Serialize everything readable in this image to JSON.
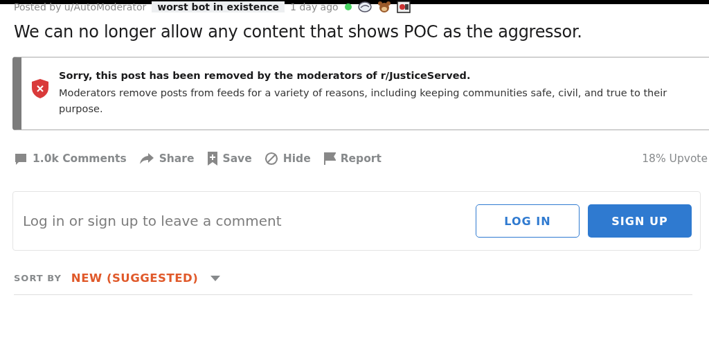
{
  "post": {
    "byline": "Posted by u/AutoModerator",
    "flair": "worst bot in existence",
    "time": "1 day ago",
    "title": "We can no longer allow any content that shows POC as the aggressor."
  },
  "removal": {
    "heading": "Sorry, this post has been removed by the moderators of r/JusticeServed.",
    "body": "Moderators remove posts from feeds for a variety of reasons, including keeping communities safe, civil, and true to their purpose."
  },
  "actions": [
    {
      "kind": "comments",
      "label": "1.0k Comments"
    },
    {
      "kind": "share",
      "label": "Share"
    },
    {
      "kind": "save",
      "label": "Save"
    },
    {
      "kind": "hide",
      "label": "Hide"
    },
    {
      "kind": "report",
      "label": "Report"
    }
  ],
  "upvoted": "18% Upvote",
  "comment_box": {
    "placeholder": "Log in or sign up to leave a comment",
    "login": "LOG IN",
    "signup": "SIGN UP"
  },
  "sort": {
    "label": "SORT BY",
    "value": "NEW (SUGGESTED)"
  }
}
